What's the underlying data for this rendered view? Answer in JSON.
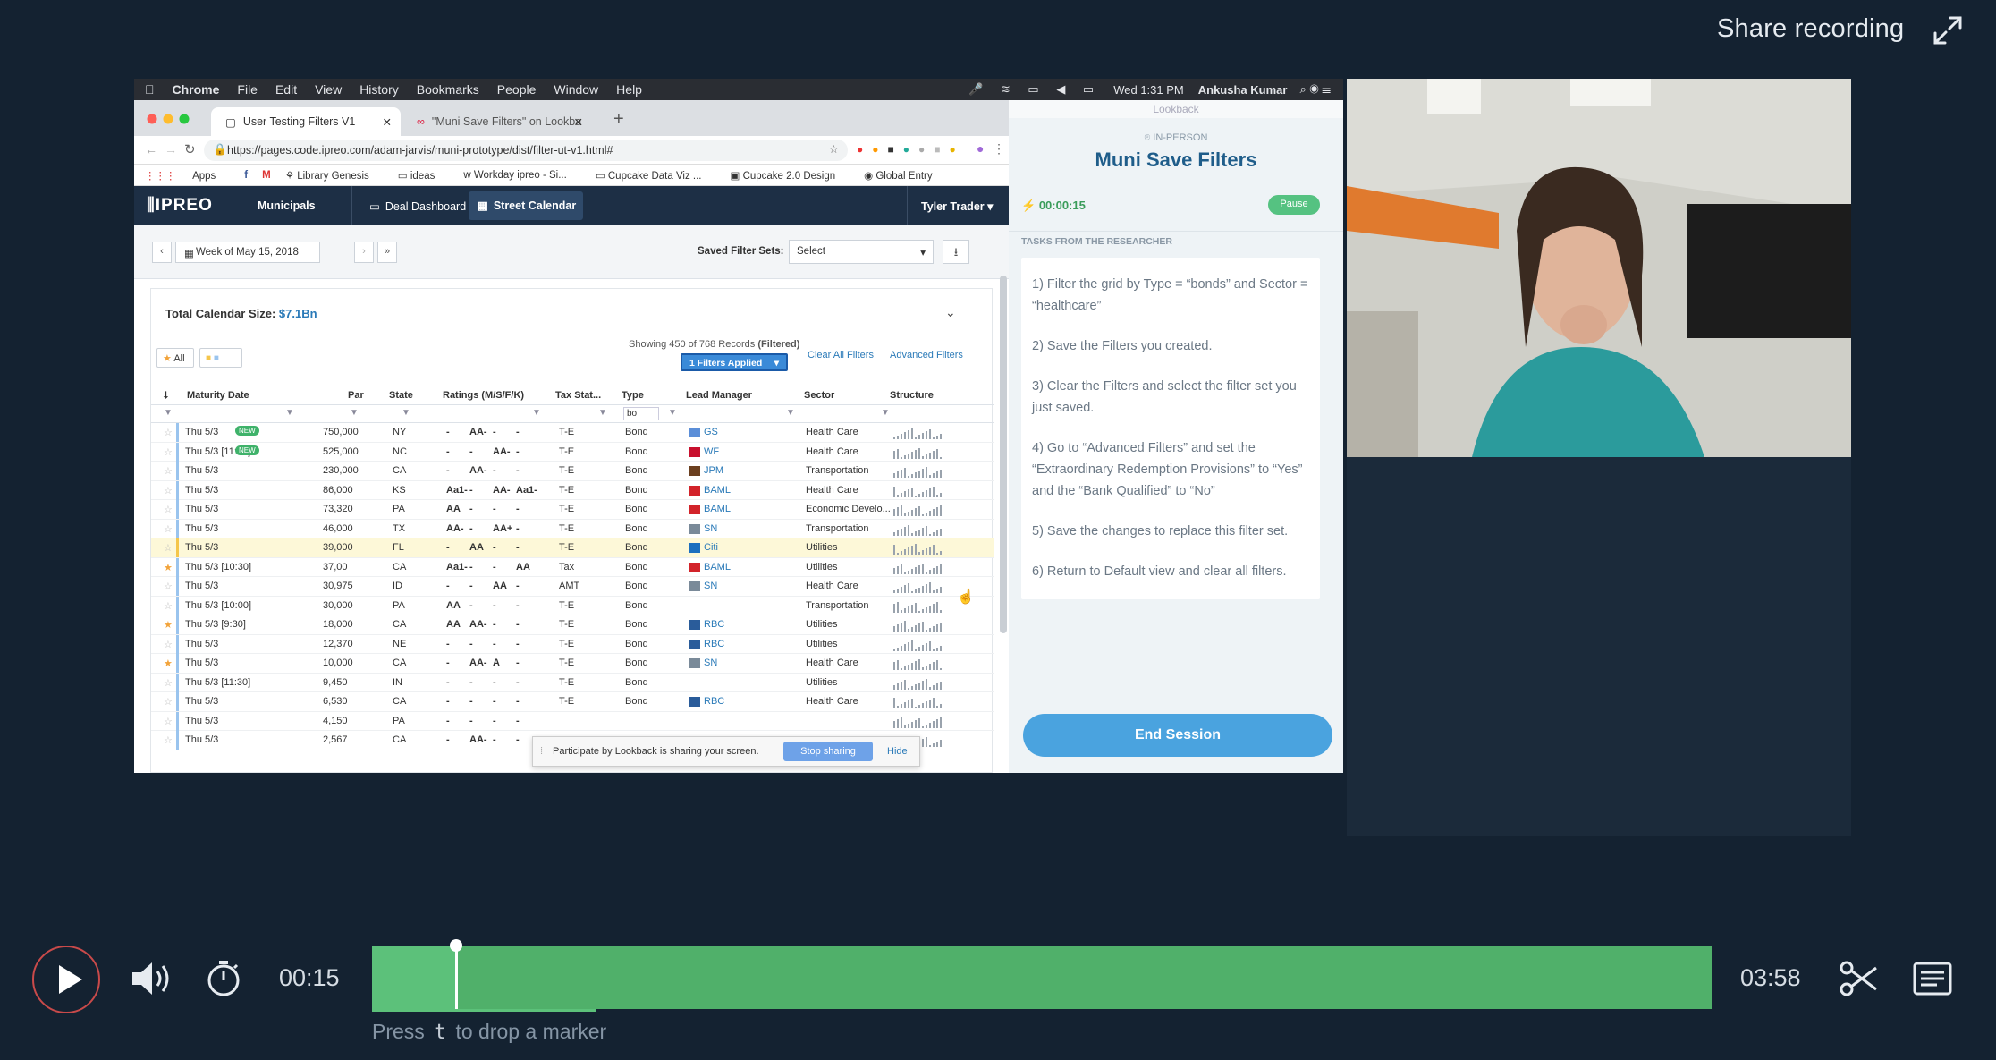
{
  "header": {
    "share_label": "Share recording"
  },
  "mac_menubar": {
    "items": [
      "Chrome",
      "File",
      "Edit",
      "View",
      "History",
      "Bookmarks",
      "People",
      "Window",
      "Help"
    ],
    "clock": "Wed 1:31 PM",
    "user": "Ankusha Kumar"
  },
  "browser": {
    "tabs": [
      {
        "label": "User Testing Filters V1",
        "active": true
      },
      {
        "label": "\"Muni Save Filters\" on Lookba",
        "active": false
      }
    ],
    "url": "https://pages.code.ipreo.com/adam-jarvis/muni-prototype/dist/filter-ut-v1.html#",
    "bookmarks": [
      "Apps",
      "Library Genesis",
      "ideas",
      "Workday ipreo - Si...",
      "Cupcake Data Viz ...",
      "Cupcake 2.0 Design",
      "Global Entry"
    ]
  },
  "app": {
    "logo": "IPREO",
    "nav": [
      "Municipals",
      "Deal Dashboard",
      "Street Calendar"
    ],
    "user_menu": "Tyler Trader",
    "week_label": "Week of May 15, 2018",
    "saved_filter_label": "Saved Filter Sets:",
    "saved_filter_value": "Select",
    "total_label": "Total Calendar Size:",
    "total_value": "$7.1Bn",
    "all_chip": "All",
    "showing": "Showing 450 of 768 Records",
    "filtered": "(Filtered)",
    "filters_applied": "1 Filters Applied",
    "clear_all": "Clear All Filters",
    "advanced": "Advanced Filters",
    "type_filter_value": "bo",
    "columns": [
      "Maturity Date",
      "Par",
      "State",
      "Ratings (M/S/F/K)",
      "Tax Stat...",
      "Type",
      "Lead Manager",
      "Sector",
      "Structure"
    ],
    "rows": [
      {
        "date": "Thu 5/3",
        "new": "NEW",
        "par": "750,000",
        "state": "NY",
        "r": [
          "-",
          "AA-",
          "-",
          "-"
        ],
        "tax": "T-E",
        "type": "Bond",
        "lm": "GS",
        "sector": "Health Care",
        "star": false
      },
      {
        "date": "Thu 5/3 [11:30]",
        "new": "NEW",
        "par": "525,000",
        "state": "NC",
        "r": [
          "-",
          "-",
          "AA-",
          "-"
        ],
        "tax": "T-E",
        "type": "Bond",
        "lm": "WF",
        "sector": "Health Care",
        "star": false
      },
      {
        "date": "Thu 5/3",
        "new": "",
        "par": "230,000",
        "state": "CA",
        "r": [
          "-",
          "AA-",
          "-",
          "-"
        ],
        "tax": "T-E",
        "type": "Bond",
        "lm": "JPM",
        "sector": "Transportation",
        "star": false
      },
      {
        "date": "Thu 5/3",
        "new": "",
        "par": "86,000",
        "state": "KS",
        "r": [
          "Aa1-",
          "-",
          "AA-",
          "Aa1-"
        ],
        "tax": "T-E",
        "type": "Bond",
        "lm": "BAML",
        "sector": "Health Care",
        "star": false
      },
      {
        "date": "Thu 5/3",
        "new": "",
        "par": "73,320",
        "state": "PA",
        "r": [
          "AA",
          "-",
          "-",
          "-"
        ],
        "tax": "T-E",
        "type": "Bond",
        "lm": "BAML",
        "sector": "Economic Develo...",
        "star": false
      },
      {
        "date": "Thu 5/3",
        "new": "",
        "par": "46,000",
        "state": "TX",
        "r": [
          "AA-",
          "-",
          "AA+",
          "-"
        ],
        "tax": "T-E",
        "type": "Bond",
        "lm": "SN",
        "sector": "Transportation",
        "star": false
      },
      {
        "date": "Thu 5/3",
        "new": "",
        "par": "39,000",
        "state": "FL",
        "r": [
          "-",
          "AA",
          "-",
          "-"
        ],
        "tax": "T-E",
        "type": "Bond",
        "lm": "Citi",
        "sector": "Utilities",
        "star": false,
        "highlight": true
      },
      {
        "date": "Thu 5/3 [10:30]",
        "new": "",
        "par": "37,00",
        "state": "CA",
        "r": [
          "Aa1-",
          "-",
          "-",
          "AA"
        ],
        "tax": "Tax",
        "type": "Bond",
        "lm": "BAML",
        "sector": "Utilities",
        "star": true
      },
      {
        "date": "Thu 5/3",
        "new": "",
        "par": "30,975",
        "state": "ID",
        "r": [
          "-",
          "-",
          "AA",
          "-"
        ],
        "tax": "AMT",
        "type": "Bond",
        "lm": "SN",
        "sector": "Health Care",
        "star": false
      },
      {
        "date": "Thu 5/3 [10:00]",
        "new": "",
        "par": "30,000",
        "state": "PA",
        "r": [
          "AA",
          "-",
          "-",
          "-"
        ],
        "tax": "T-E",
        "type": "Bond",
        "lm": "",
        "sector": "Transportation",
        "star": false
      },
      {
        "date": "Thu 5/3 [9:30]",
        "new": "",
        "par": "18,000",
        "state": "CA",
        "r": [
          "AA",
          "AA-",
          "-",
          "-"
        ],
        "tax": "T-E",
        "type": "Bond",
        "lm": "RBC",
        "sector": "Utilities",
        "star": true
      },
      {
        "date": "Thu 5/3",
        "new": "",
        "par": "12,370",
        "state": "NE",
        "r": [
          "-",
          "-",
          "-",
          "-"
        ],
        "tax": "T-E",
        "type": "Bond",
        "lm": "RBC",
        "sector": "Utilities",
        "star": false
      },
      {
        "date": "Thu 5/3",
        "new": "",
        "par": "10,000",
        "state": "CA",
        "r": [
          "-",
          "AA-",
          "A",
          "-"
        ],
        "tax": "T-E",
        "type": "Bond",
        "lm": "SN",
        "sector": "Health Care",
        "star": true
      },
      {
        "date": "Thu 5/3 [11:30]",
        "new": "",
        "par": "9,450",
        "state": "IN",
        "r": [
          "-",
          "-",
          "-",
          "-"
        ],
        "tax": "T-E",
        "type": "Bond",
        "lm": "",
        "sector": "Utilities",
        "star": false
      },
      {
        "date": "Thu 5/3",
        "new": "",
        "par": "6,530",
        "state": "CA",
        "r": [
          "-",
          "-",
          "-",
          "-"
        ],
        "tax": "T-E",
        "type": "Bond",
        "lm": "RBC",
        "sector": "Health Care",
        "star": false
      },
      {
        "date": "Thu 5/3",
        "new": "",
        "par": "4,150",
        "state": "PA",
        "r": [
          "-",
          "-",
          "-",
          "-"
        ],
        "tax": "",
        "type": "",
        "lm": "",
        "sector": "",
        "star": false
      },
      {
        "date": "Thu 5/3",
        "new": "",
        "par": "2,567",
        "state": "CA",
        "r": [
          "-",
          "AA-",
          "-",
          "-"
        ],
        "tax": "",
        "type": "",
        "lm": "",
        "sector": "",
        "star": false
      }
    ],
    "share_bar": {
      "text": "Participate by Lookback is sharing your screen.",
      "stop": "Stop sharing",
      "hide": "Hide"
    }
  },
  "lookback": {
    "window_title": "Lookback",
    "mode": "IN-PERSON",
    "title": "Muni Save Filters",
    "timer": "00:00:15",
    "pause": "Pause",
    "section": "TASKS FROM THE RESEARCHER",
    "tasks": [
      "1) Filter the grid by Type = “bonds” and Sector = “healthcare”",
      "2) Save the Filters you created.",
      "3) Clear the Filters and select the filter set you just saved.",
      "4) Go to “Advanced Filters” and set the “Extraordinary Redemption Provisions” to “Yes” and the “Bank Qualified” to “No”",
      "5) Save the changes to replace this filter set.",
      "6) Return to Default view and clear all filters."
    ],
    "end_session": "End Session"
  },
  "player": {
    "current_time": "00:15",
    "total_time": "03:58",
    "progress": 0.063,
    "marker_hint_pre": "Press",
    "marker_key": "t",
    "marker_hint_post": "to drop a marker"
  },
  "colors": {
    "background": "#142231",
    "timeline": "#50b06a",
    "play_ring": "#c94a4a",
    "end_session": "#4aa3df"
  }
}
